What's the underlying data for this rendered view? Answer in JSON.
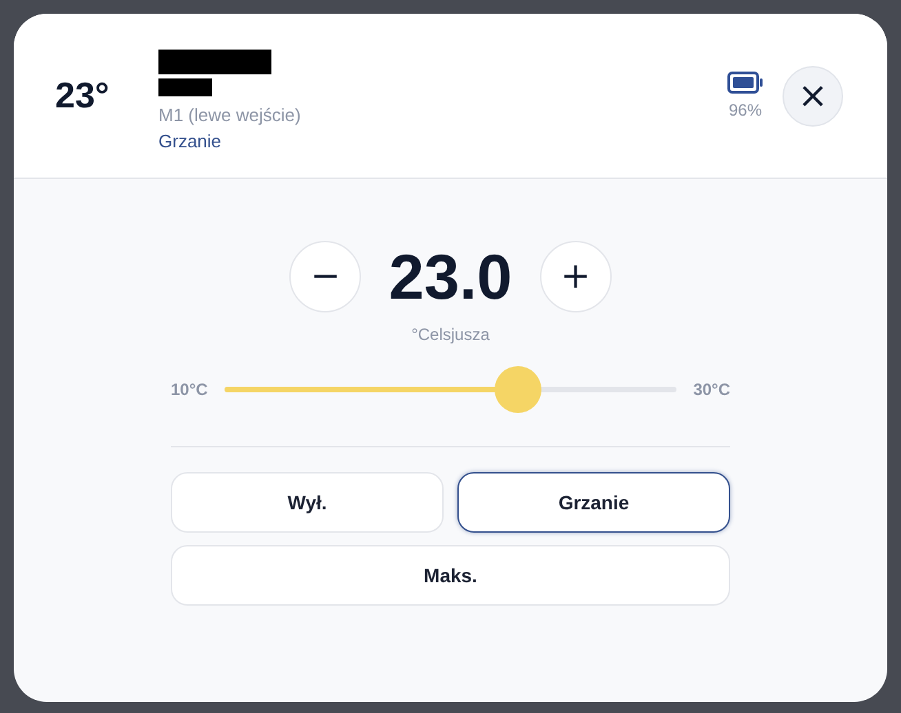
{
  "header": {
    "current_temp": "23°",
    "subtitle": "M1 (lewe wejście)",
    "status": "Grzanie",
    "battery": "96%",
    "close": "×"
  },
  "setpoint": {
    "minus": "−",
    "value": "23.0",
    "plus": "+",
    "unit": "°Celsjusza"
  },
  "slider": {
    "min_label": "10°C",
    "max_label": "30°C",
    "level": 0.65
  },
  "modes": [
    {
      "label": "Wył.",
      "selected": false
    },
    {
      "label": "Grzanie",
      "selected": true
    },
    {
      "label": "Maks.",
      "selected": false
    }
  ]
}
